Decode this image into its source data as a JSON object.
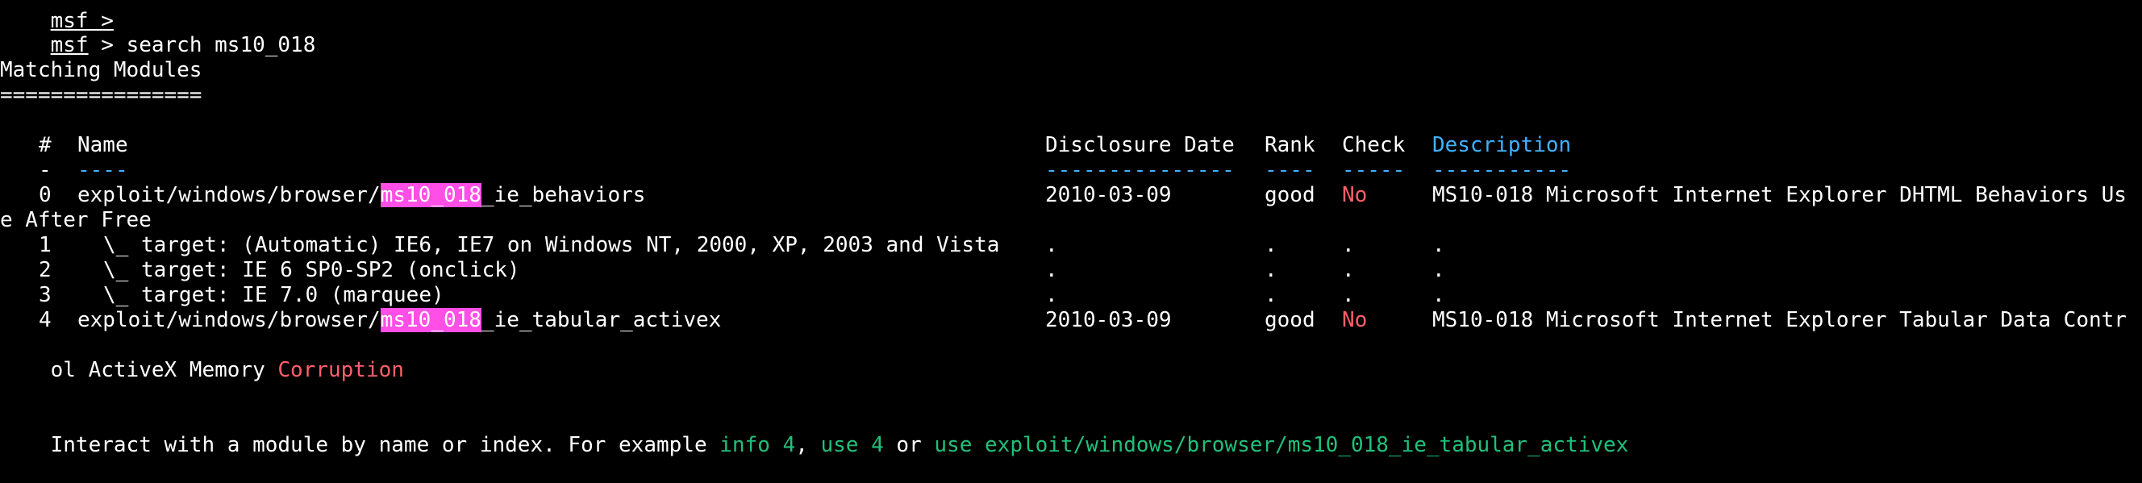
{
  "terminal": {
    "top_cut": "msf >",
    "prompt": "msf",
    "prompt_sep": " > ",
    "command": "search ms10_018",
    "section_title": "Matching Modules",
    "section_rule": "================",
    "headers": {
      "num": "#",
      "name": "Name",
      "date": "Disclosure Date",
      "rank": "Rank",
      "check": "Check",
      "desc": "Description"
    },
    "header_rules": {
      "num": "-",
      "name": "----",
      "date": "---------------",
      "rank": "----",
      "check": "-----",
      "desc": "-----------"
    },
    "rows": [
      {
        "index": "0",
        "name_prefix": "exploit/windows/browser/",
        "name_match": "ms10_018",
        "name_suffix": "_ie_behaviors",
        "date": "2010-03-09",
        "rank": "good",
        "check": "No",
        "desc_first": "MS10-018 Microsoft Internet Explorer DHTML Behaviors Us",
        "desc_wrap": "e After Free"
      },
      {
        "index": "1",
        "target": "\\_ target: (Automatic) IE6, IE7 on Windows NT, 2000, XP, 2003 and Vista",
        "date": ".",
        "rank": ".",
        "check": ".",
        "desc": "."
      },
      {
        "index": "2",
        "target": "\\_ target: IE 6 SP0-SP2 (onclick)",
        "date": ".",
        "rank": ".",
        "check": ".",
        "desc": "."
      },
      {
        "index": "3",
        "target": "\\_ target: IE 7.0 (marquee)",
        "date": ".",
        "rank": ".",
        "check": ".",
        "desc": "."
      },
      {
        "index": "4",
        "name_prefix": "exploit/windows/browser/",
        "name_match": "ms10_018",
        "name_suffix": "_ie_tabular_activex",
        "date": "2010-03-09",
        "rank": "good",
        "check": "No",
        "desc_first": "MS10-018 Microsoft Internet Explorer Tabular Data Contr",
        "desc_wrap_plain": "ol ActiveX Memory ",
        "desc_wrap_red": "Corruption"
      }
    ],
    "footer": {
      "text1": "Interact with a module by name or index. For example ",
      "cmd1": "info 4",
      "sep1": ", ",
      "cmd2": "use 4",
      "sep2": " or ",
      "cmd3": "use exploit/windows/browser/ms10_018_ie_tabular_activex"
    },
    "colors": {
      "background": "#000000",
      "text": "#ffffff",
      "highlight": "#ff4fe6",
      "red": "#ff5f6a",
      "header_blue": "#3db3ff",
      "green": "#21c07a"
    }
  }
}
